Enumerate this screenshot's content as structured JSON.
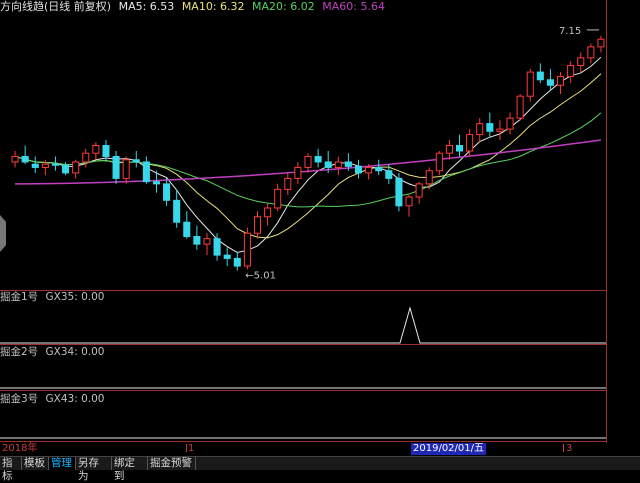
{
  "header": {
    "title": "方向线趋(日线 前复权)",
    "ma5": "MA5: 6.53",
    "ma10": "MA10: 6.32",
    "ma20": "MA20: 6.02",
    "ma60": "MA60: 5.64",
    "colors": {
      "title": "#e0e0e0",
      "ma5": "#e8e8e8",
      "ma10": "#e8e07a",
      "ma20": "#5ad05a",
      "ma60": "#c040c0"
    }
  },
  "annotations": {
    "high": "7.15",
    "low": "5.01"
  },
  "panels": [
    {
      "label": "掘金1号",
      "value": "GX35: 0.00"
    },
    {
      "label": "掘金2号",
      "value": "GX34: 0.00"
    },
    {
      "label": "掘金3号",
      "value": "GX43: 0.00"
    }
  ],
  "axis": {
    "year": "2018年",
    "m1": "1",
    "cursor_date": "2019/02/01/五",
    "m3": "3"
  },
  "tabs": [
    "指标",
    "模板",
    "管理",
    "另存为",
    "绑定到",
    "掘金预警"
  ],
  "active_tab": "管理",
  "chart_data": {
    "type": "candlestick",
    "candles": [
      [
        6.0,
        6.1,
        5.95,
        6.05
      ],
      [
        6.05,
        6.15,
        5.98,
        6.0
      ],
      [
        5.98,
        6.05,
        5.9,
        5.95
      ],
      [
        5.95,
        6.02,
        5.88,
        5.98
      ],
      [
        5.98,
        6.05,
        5.92,
        5.97
      ],
      [
        5.97,
        6.0,
        5.88,
        5.9
      ],
      [
        5.9,
        6.02,
        5.85,
        6.0
      ],
      [
        6.0,
        6.12,
        5.95,
        6.08
      ],
      [
        6.08,
        6.18,
        6.02,
        6.15
      ],
      [
        6.15,
        6.2,
        6.0,
        6.05
      ],
      [
        6.05,
        6.1,
        5.8,
        5.85
      ],
      [
        5.85,
        6.05,
        5.8,
        6.02
      ],
      [
        6.02,
        6.1,
        5.95,
        6.0
      ],
      [
        6.0,
        6.05,
        5.8,
        5.82
      ],
      [
        5.82,
        5.92,
        5.72,
        5.8
      ],
      [
        5.8,
        5.85,
        5.6,
        5.65
      ],
      [
        5.65,
        5.75,
        5.4,
        5.45
      ],
      [
        5.45,
        5.55,
        5.3,
        5.32
      ],
      [
        5.32,
        5.42,
        5.2,
        5.25
      ],
      [
        5.25,
        5.35,
        5.15,
        5.3
      ],
      [
        5.3,
        5.35,
        5.1,
        5.15
      ],
      [
        5.15,
        5.22,
        5.05,
        5.12
      ],
      [
        5.12,
        5.18,
        5.01,
        5.05
      ],
      [
        5.05,
        5.4,
        5.02,
        5.35
      ],
      [
        5.35,
        5.55,
        5.3,
        5.5
      ],
      [
        5.5,
        5.62,
        5.42,
        5.58
      ],
      [
        5.58,
        5.8,
        5.55,
        5.75
      ],
      [
        5.75,
        5.9,
        5.7,
        5.85
      ],
      [
        5.85,
        6.0,
        5.8,
        5.95
      ],
      [
        5.95,
        6.08,
        5.9,
        6.05
      ],
      [
        6.05,
        6.12,
        5.95,
        6.0
      ],
      [
        6.0,
        6.1,
        5.9,
        5.95
      ],
      [
        5.95,
        6.05,
        5.88,
        6.0
      ],
      [
        6.0,
        6.08,
        5.92,
        5.96
      ],
      [
        5.96,
        6.02,
        5.85,
        5.9
      ],
      [
        5.9,
        5.98,
        5.84,
        5.95
      ],
      [
        5.95,
        6.02,
        5.88,
        5.92
      ],
      [
        5.92,
        5.98,
        5.8,
        5.85
      ],
      [
        5.85,
        5.9,
        5.55,
        5.6
      ],
      [
        5.6,
        5.7,
        5.5,
        5.68
      ],
      [
        5.68,
        5.82,
        5.62,
        5.8
      ],
      [
        5.8,
        5.95,
        5.75,
        5.92
      ],
      [
        5.92,
        6.1,
        5.88,
        6.08
      ],
      [
        6.08,
        6.2,
        6.02,
        6.15
      ],
      [
        6.15,
        6.25,
        6.05,
        6.1
      ],
      [
        6.1,
        6.3,
        6.05,
        6.25
      ],
      [
        6.25,
        6.4,
        6.18,
        6.35
      ],
      [
        6.35,
        6.45,
        6.22,
        6.28
      ],
      [
        6.28,
        6.38,
        6.2,
        6.3
      ],
      [
        6.3,
        6.45,
        6.25,
        6.4
      ],
      [
        6.4,
        6.62,
        6.38,
        6.6
      ],
      [
        6.6,
        6.85,
        6.55,
        6.82
      ],
      [
        6.82,
        6.9,
        6.72,
        6.75
      ],
      [
        6.75,
        6.85,
        6.65,
        6.7
      ],
      [
        6.7,
        6.82,
        6.62,
        6.78
      ],
      [
        6.78,
        6.92,
        6.72,
        6.88
      ],
      [
        6.88,
        7.0,
        6.82,
        6.95
      ],
      [
        6.95,
        7.08,
        6.9,
        7.05
      ],
      [
        7.05,
        7.15,
        7.0,
        7.12
      ]
    ],
    "ma60_range": [
      5.8,
      6.2
    ]
  }
}
